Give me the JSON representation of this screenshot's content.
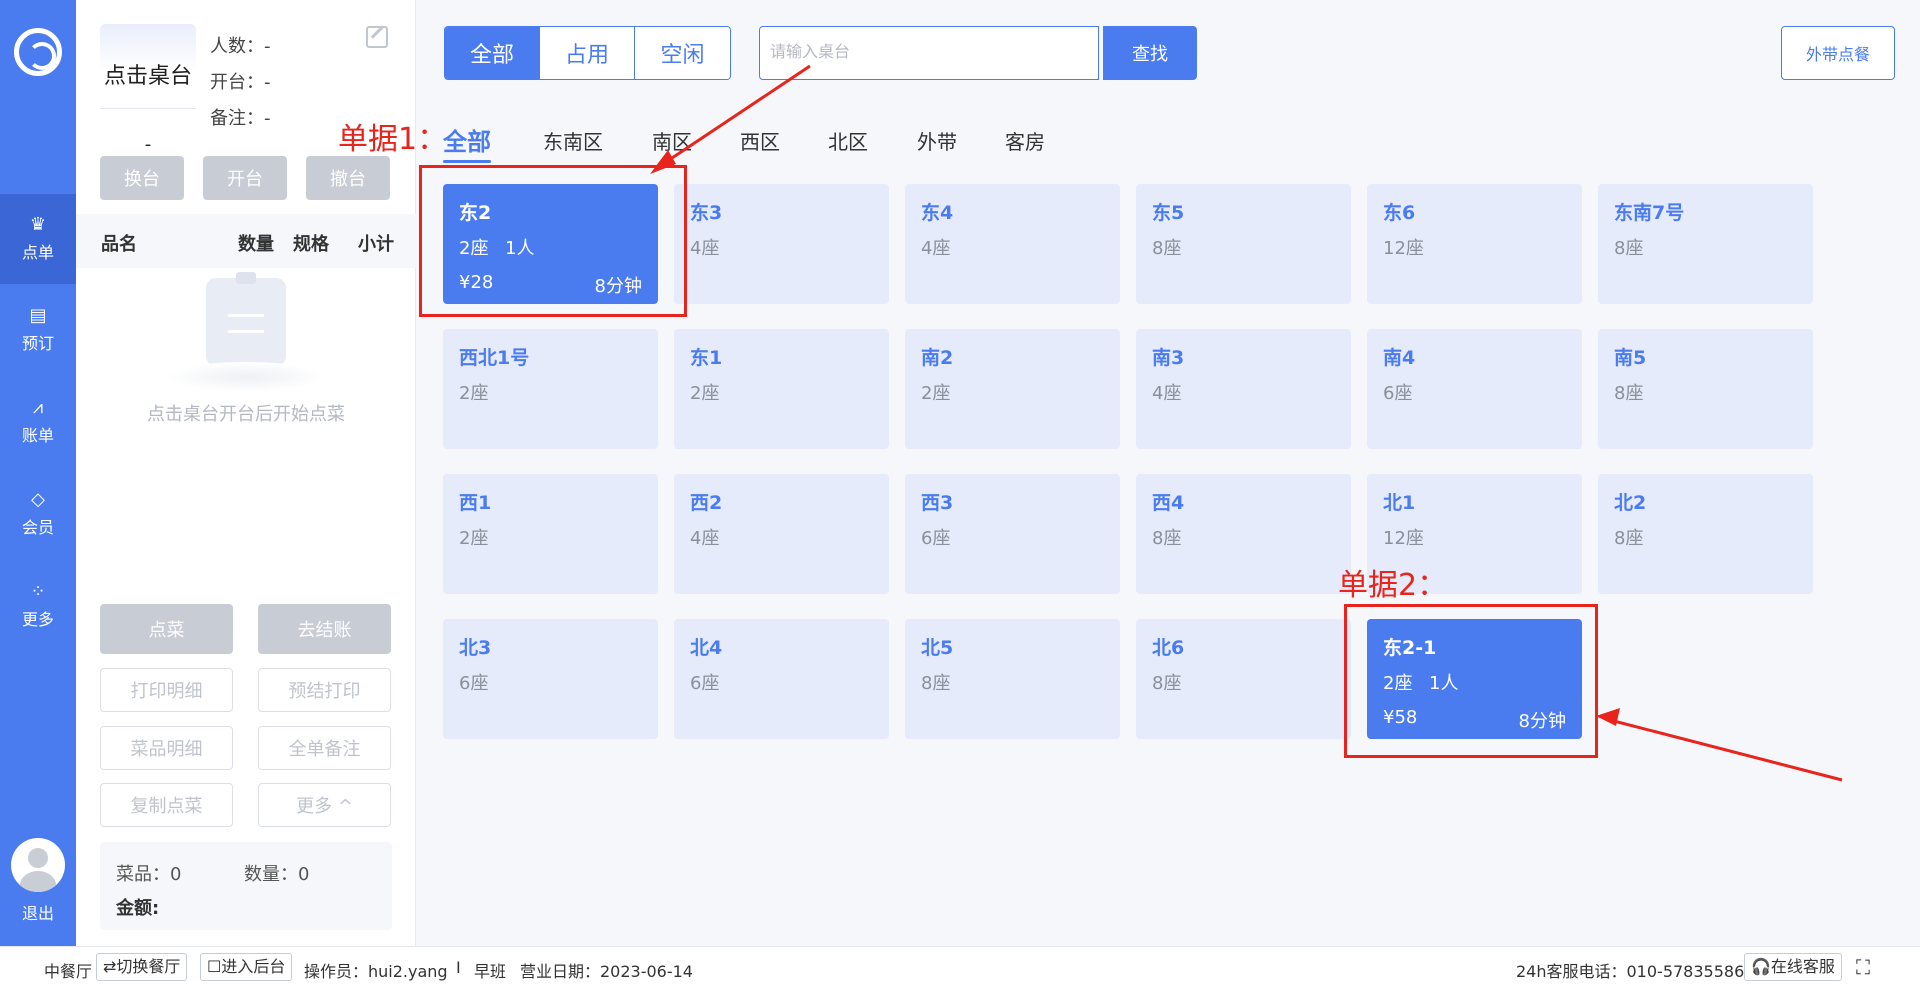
{
  "nav": {
    "items": [
      {
        "label": "点单",
        "icon": "chef-hat-icon"
      },
      {
        "label": "预订",
        "icon": "book-icon"
      },
      {
        "label": "账单",
        "icon": "chart-icon"
      },
      {
        "label": "会员",
        "icon": "diamond-icon"
      },
      {
        "label": "更多",
        "icon": "grid-icon"
      }
    ],
    "logout": "退出"
  },
  "panel": {
    "table_name": "点击桌台",
    "table_sub": "-",
    "info": [
      "人数：-",
      "开台：-",
      "备注：-"
    ],
    "top_buttons": [
      "换台",
      "开台",
      "撤台"
    ],
    "columns": [
      "品名",
      "数量",
      "规格",
      "小计"
    ],
    "empty_text": "点击桌台开台后开始点菜",
    "action_buttons": [
      "点菜",
      "去结账"
    ],
    "outline_buttons": [
      "打印明细",
      "预结打印",
      "菜品明细",
      "全单备注",
      "复制点菜",
      "更多 ^"
    ],
    "summary": {
      "dishes": "菜品：0",
      "qty": "数量：0",
      "amount": "金额:"
    }
  },
  "filters": [
    "全部",
    "占用",
    "空闲"
  ],
  "search": {
    "placeholder": "请输入桌台",
    "button": "查找"
  },
  "takeout_button": "外带点餐",
  "zones": [
    "全部",
    "东南区",
    "南区",
    "西区",
    "北区",
    "外带",
    "客房"
  ],
  "tables": [
    {
      "name": "东2",
      "seats": "2座",
      "busy": true,
      "people": "1人",
      "price": "¥28",
      "time": "8分钟"
    },
    {
      "name": "东3",
      "seats": "4座"
    },
    {
      "name": "东4",
      "seats": "4座"
    },
    {
      "name": "东5",
      "seats": "8座"
    },
    {
      "name": "东6",
      "seats": "12座"
    },
    {
      "name": "东南7号",
      "seats": "8座"
    },
    {
      "name": "西北1号",
      "seats": "2座"
    },
    {
      "name": "东1",
      "seats": "2座"
    },
    {
      "name": "南2",
      "seats": "2座"
    },
    {
      "name": "南3",
      "seats": "4座"
    },
    {
      "name": "南4",
      "seats": "6座"
    },
    {
      "name": "南5",
      "seats": "8座"
    },
    {
      "name": "西1",
      "seats": "2座"
    },
    {
      "name": "西2",
      "seats": "4座"
    },
    {
      "name": "西3",
      "seats": "6座"
    },
    {
      "name": "西4",
      "seats": "8座"
    },
    {
      "name": "北1",
      "seats": "12座"
    },
    {
      "name": "北2",
      "seats": "8座"
    },
    {
      "name": "北3",
      "seats": "6座"
    },
    {
      "name": "北4",
      "seats": "6座"
    },
    {
      "name": "北5",
      "seats": "8座"
    },
    {
      "name": "北6",
      "seats": "8座"
    },
    {
      "name": "东2-1",
      "seats": "2座",
      "busy": true,
      "people": "1人",
      "price": "¥58",
      "time": "8分钟"
    }
  ],
  "annotations": [
    "单据1：",
    "单据2："
  ],
  "footer": {
    "restaurant": "中餐厅",
    "switch": "⇄切换餐厅",
    "backend": "☐进入后台",
    "operator": "操作员：hui2.yang",
    "sep": "I",
    "shift": "早班",
    "biz_date": "营业日期：2023-06-14",
    "hotline": "24h客服电话：010-57835586",
    "online": "🎧在线客服"
  },
  "colors": {
    "primary": "#4a7cf0",
    "card": "#e6ebfb",
    "annotation": "#e8241c"
  }
}
